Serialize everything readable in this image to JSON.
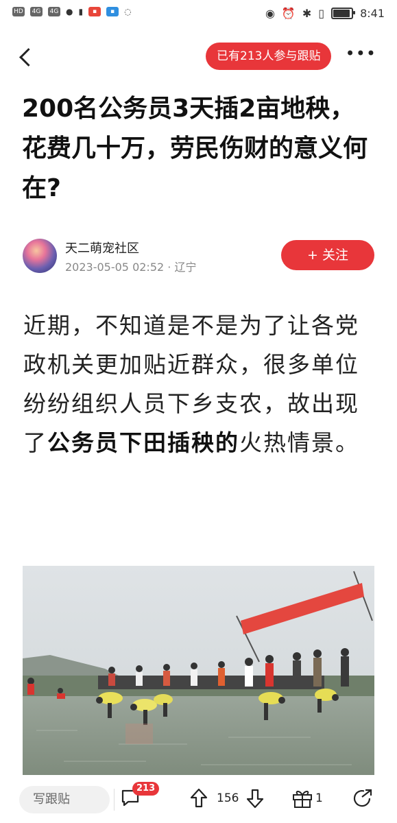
{
  "status_bar": {
    "left_items": [
      "HD",
      "4G",
      "4G"
    ],
    "time": "8:41",
    "battery_level": 0.85
  },
  "nav": {
    "participants_pill": "已有213人参与跟贴"
  },
  "article": {
    "title": "200名公务员3天插2亩地秧，花费几十万，劳民伤财的意义何在?",
    "author": "天二萌宠社区",
    "timestamp": "2023-05-05 02:52",
    "location": "辽宁",
    "follow_label": "+ 关注",
    "body_part1": "近期，不知道是不是为了让各党政机关更加贴近群众，很多单位纷纷组织人员下乡支农，故出现了",
    "body_bold": "公务员下田插秧的",
    "body_part2": "火热情景。"
  },
  "bottom_bar": {
    "comment_placeholder": "写跟贴",
    "comment_count": "213",
    "vote_count": "156",
    "gift_count": "1"
  },
  "colors": {
    "accent": "#e8363a"
  }
}
